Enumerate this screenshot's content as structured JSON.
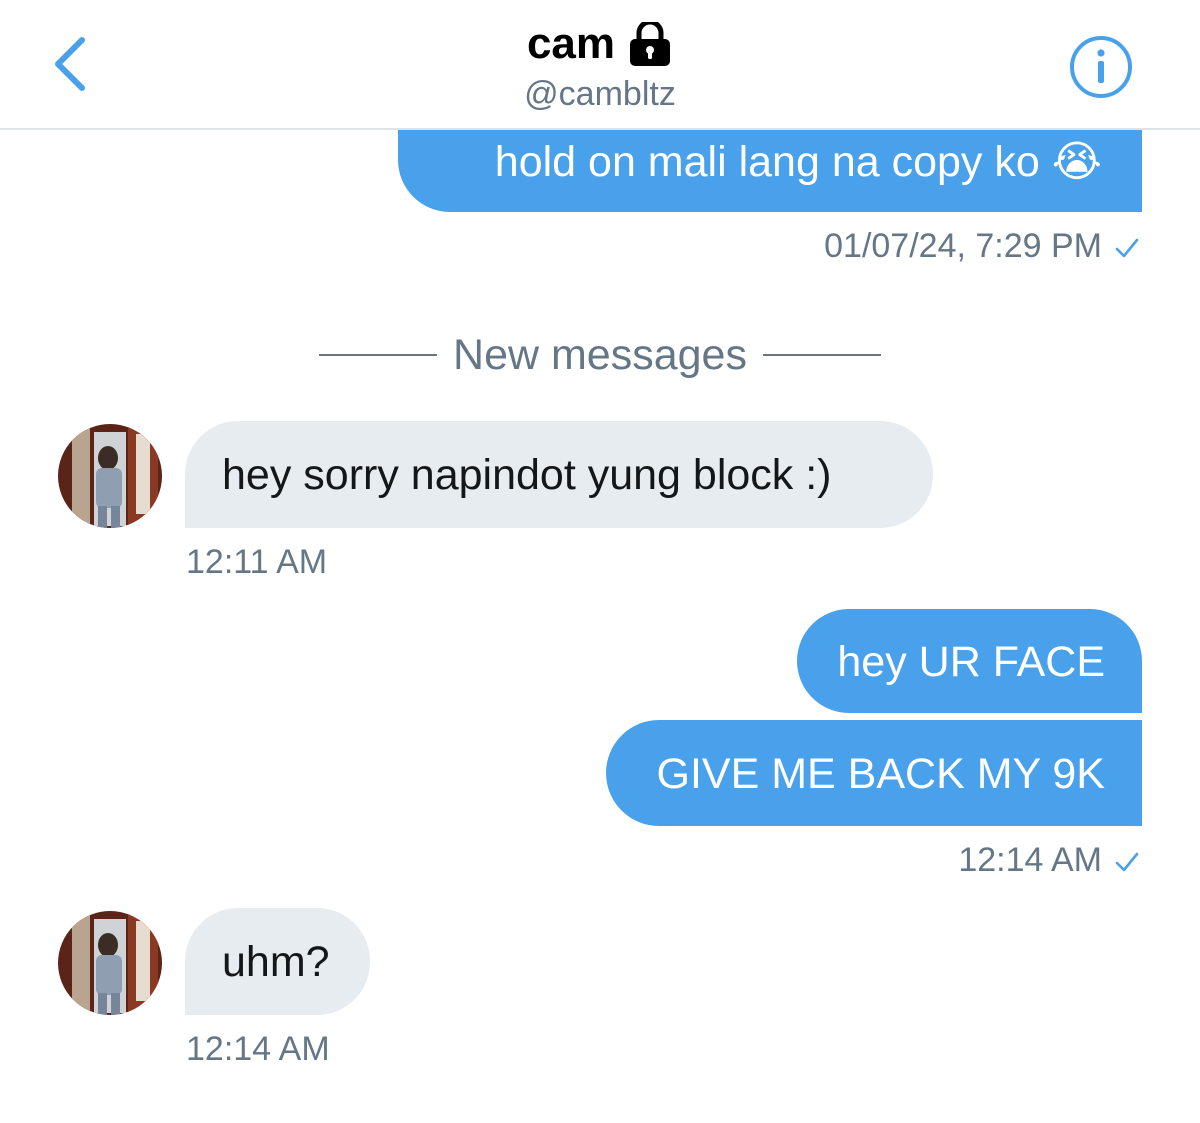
{
  "header": {
    "name": "cam",
    "handle": "@cambltz",
    "back_icon": "chevron-left-icon",
    "lock_icon": "lock-icon",
    "info_icon": "info-icon"
  },
  "messages": {
    "m1": {
      "text": "hold on mali lang na copy ko 😭",
      "time": "01/07/24, 7:29 PM"
    },
    "divider": "New messages",
    "m2": {
      "text": "hey sorry napindot yung block :)",
      "time": "12:11 AM"
    },
    "m3": {
      "text": "hey UR FACE"
    },
    "m4": {
      "text": "GIVE ME BACK MY 9K",
      "time": "12:14 AM"
    },
    "m5": {
      "text": "uhm?",
      "time": "12:14 AM"
    }
  },
  "colors": {
    "accent": "#4aa1eb",
    "incoming_bubble": "#e6ecf0",
    "secondary_text": "#657786"
  }
}
